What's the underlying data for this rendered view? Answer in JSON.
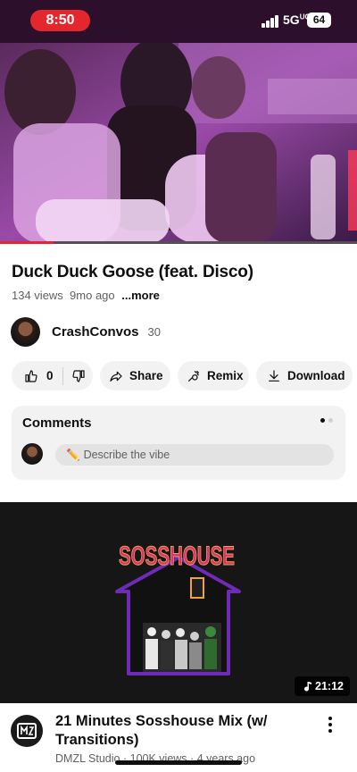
{
  "status_bar": {
    "time": "8:50",
    "network": "5G",
    "network_sup": "UC",
    "battery": "64"
  },
  "player": {
    "progress_fraction": 0.15
  },
  "video": {
    "title": "Duck Duck Goose (feat. Disco)",
    "views": "134 views",
    "age": "9mo ago",
    "more": "...more"
  },
  "channel": {
    "name": "CrashConvos",
    "subscribers": "30"
  },
  "actions": {
    "like_count": "0",
    "share": "Share",
    "remix": "Remix",
    "download": "Download"
  },
  "comments": {
    "title": "Comments",
    "placeholder": "Describe the vibe",
    "placeholder_icon": "✏️"
  },
  "next_video": {
    "thumbnail_text": "SOSSHOUSE",
    "duration": "21:12",
    "title": "21 Minutes Sosshouse Mix (w/ Transitions)",
    "channel": "DMZL Studio",
    "views": "100K views",
    "age": "4 years ago",
    "separator": "·"
  },
  "colors": {
    "accent_red": "#e4272d",
    "chip_bg": "#f2f2f2",
    "thumb_orange": "#f1a33a",
    "thumb_pink": "#d7337a",
    "thumb_purple": "#6e2bb8"
  }
}
